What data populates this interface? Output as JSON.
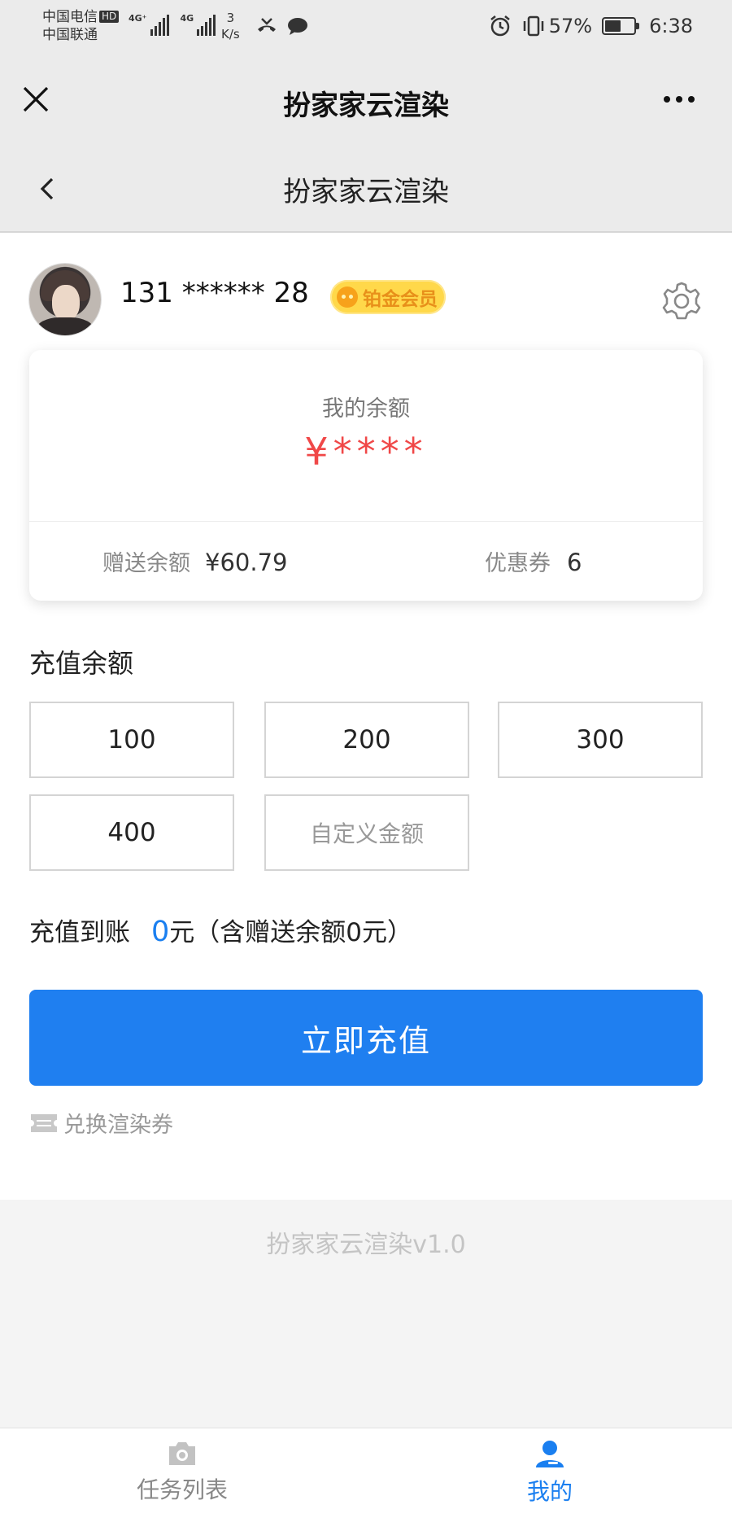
{
  "status_bar": {
    "carrier_1": "中国电信",
    "hd_badge": "HD",
    "carrier_2": "中国联通",
    "network_1": "4G⁺",
    "network_2": "4G",
    "speed_value": "3",
    "speed_unit": "K/s",
    "battery_percent": "57%",
    "battery_level": 0.57,
    "time": "6:38",
    "icons": [
      "missed-call-icon",
      "chat-bubble-icon",
      "alarm-icon",
      "vibrate-icon",
      "battery-icon"
    ]
  },
  "title_bar": {
    "title": "扮家家云渲染",
    "left_icon": "close-icon",
    "right_icon": "more-dots-icon"
  },
  "nav_bar": {
    "title": "扮家家云渲染",
    "left_icon": "back-chevron-icon"
  },
  "profile": {
    "phone": "131 ****** 28",
    "badge": "铂金会员",
    "settings_icon": "gear-icon"
  },
  "balance_card": {
    "label": "我的余额",
    "value": "¥****",
    "bonus_label": "赠送余额",
    "bonus_value": "¥60.79",
    "coupon_label": "优惠券",
    "coupon_value": "6"
  },
  "recharge": {
    "section_title": "充值余额",
    "amounts": [
      "100",
      "200",
      "300",
      "400"
    ],
    "custom_placeholder": "自定义金额",
    "arrival_label": "充值到账",
    "arrival_amount": "0",
    "arrival_suffix": "元（含赠送余额0元）",
    "submit_label": "立即充值",
    "redeem_label": "兑换渲染券"
  },
  "footer": {
    "version": "扮家家云渲染v1.0"
  },
  "tab_bar": {
    "tabs": [
      {
        "label": "任务列表",
        "icon": "camera-icon",
        "active": false
      },
      {
        "label": "我的",
        "icon": "user-icon",
        "active": true
      }
    ]
  },
  "colors": {
    "accent": "#1f7ff0",
    "balance_red": "#f04848",
    "badge_yellow": "#ffd84a",
    "badge_text": "#e8901a"
  }
}
